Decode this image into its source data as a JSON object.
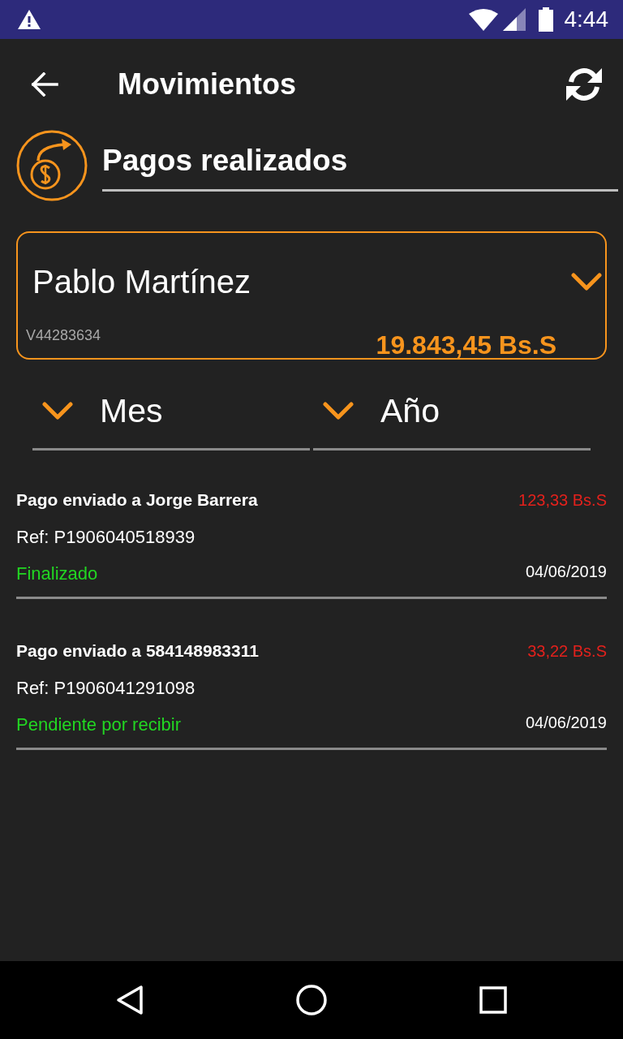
{
  "status_bar": {
    "time": "4:44"
  },
  "app_bar": {
    "title": "Movimientos"
  },
  "section": {
    "title": "Pagos realizados"
  },
  "account": {
    "name": "Pablo Martínez",
    "id": "V44283634",
    "balance": "19.843,45 Bs.S"
  },
  "filters": [
    {
      "label": "Mes"
    },
    {
      "label": "Año"
    }
  ],
  "transactions": [
    {
      "title": "Pago enviado a Jorge Barrera",
      "amount": "123,33 Bs.S",
      "reference": "Ref: P1906040518939",
      "status": "Finalizado",
      "date": "04/06/2019"
    },
    {
      "title": "Pago enviado a 584148983311",
      "amount": "33,22 Bs.S",
      "reference": "Ref: P1906041291098",
      "status": "Pendiente por recibir",
      "date": "04/06/2019"
    }
  ]
}
